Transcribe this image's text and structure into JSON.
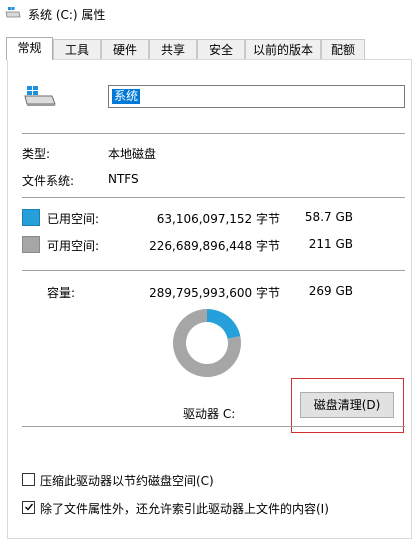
{
  "window": {
    "title": "系统 (C:) 属性"
  },
  "tabs": [
    {
      "label": "常规",
      "active": true
    },
    {
      "label": "工具"
    },
    {
      "label": "硬件"
    },
    {
      "label": "共享"
    },
    {
      "label": "安全"
    },
    {
      "label": "以前的版本"
    },
    {
      "label": "配额"
    }
  ],
  "drive": {
    "name": "系统",
    "icon": "drive-icon"
  },
  "info": {
    "type_label": "类型:",
    "type_value": "本地磁盘",
    "fs_label": "文件系统:",
    "fs_value": "NTFS"
  },
  "space": {
    "used": {
      "label": "已用空间:",
      "bytes": "63,106,097,152 字节",
      "size": "58.7 GB",
      "color": "#26a0da"
    },
    "free": {
      "label": "可用空间:",
      "bytes": "226,689,896,448 字节",
      "size": "211 GB",
      "color": "#a6a6a6"
    },
    "capacity": {
      "label": "容量:",
      "bytes": "289,795,993,600 字节",
      "size": "269 GB"
    },
    "used_fraction": 0.2178
  },
  "drive_label": "驱动器 C:",
  "cleanup_button": "磁盘清理(D)",
  "options": {
    "compress": {
      "label": "压缩此驱动器以节约磁盘空间(C)",
      "checked": false
    },
    "index": {
      "label": "除了文件属性外，还允许索引此驱动器上文件的内容(I)",
      "checked": true
    }
  }
}
